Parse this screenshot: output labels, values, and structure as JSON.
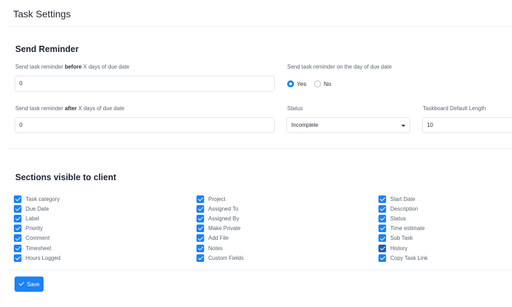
{
  "page": {
    "title": "Task Settings"
  },
  "reminder": {
    "title": "Send Reminder",
    "before_label_prefix": "Send task reminder ",
    "before_label_bold": "before",
    "before_label_suffix": " X days of due date",
    "before_value": "0",
    "on_day_label": "Send task reminder on the day of due date",
    "yes_label": "Yes",
    "no_label": "No",
    "on_day_selected": "Yes",
    "after_label_prefix": "Send task reminder ",
    "after_label_bold": "after",
    "after_label_suffix": " X days of due date",
    "after_value": "0",
    "status_label": "Status",
    "status_value": "Incomplete",
    "taskboard_label": "Taskboard Default Length",
    "taskboard_value": "10"
  },
  "visibility": {
    "title": "Sections visible to client",
    "col1": [
      "Task category",
      "Due Date",
      "Label",
      "Priority",
      "Comment",
      "Timesheet",
      "Hours Logged"
    ],
    "col2": [
      "Project",
      "Assigned To",
      "Assigned By",
      "Make Private",
      "Add File",
      "Notes",
      "Custom Fields"
    ],
    "col3": [
      "Start Date",
      "Description",
      "Status",
      "Time estimate",
      "Sub Task",
      "History",
      "Copy Task Link"
    ]
  },
  "actions": {
    "save_label": "Save"
  },
  "colors": {
    "accent": "#1d82f5"
  }
}
